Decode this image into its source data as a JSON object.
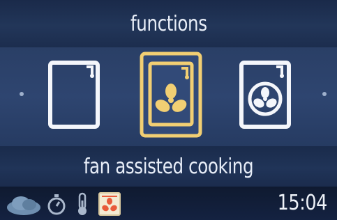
{
  "header": {
    "title": "functions"
  },
  "carousel": {
    "items": [
      {
        "icon": "conventional-oven-icon",
        "selected": false
      },
      {
        "icon": "fan-assisted-icon",
        "selected": true
      },
      {
        "icon": "fan-ring-icon",
        "selected": false
      }
    ],
    "selected_label": "fan assisted cooking"
  },
  "status": {
    "icons": [
      "cloud-icon",
      "timer-icon",
      "thermometer-icon",
      "active-mode-icon"
    ],
    "time": "15:04"
  },
  "colors": {
    "selected_accent": "#f2cf73",
    "icon_outline": "#f4f6fb",
    "background": "#2e4570"
  }
}
